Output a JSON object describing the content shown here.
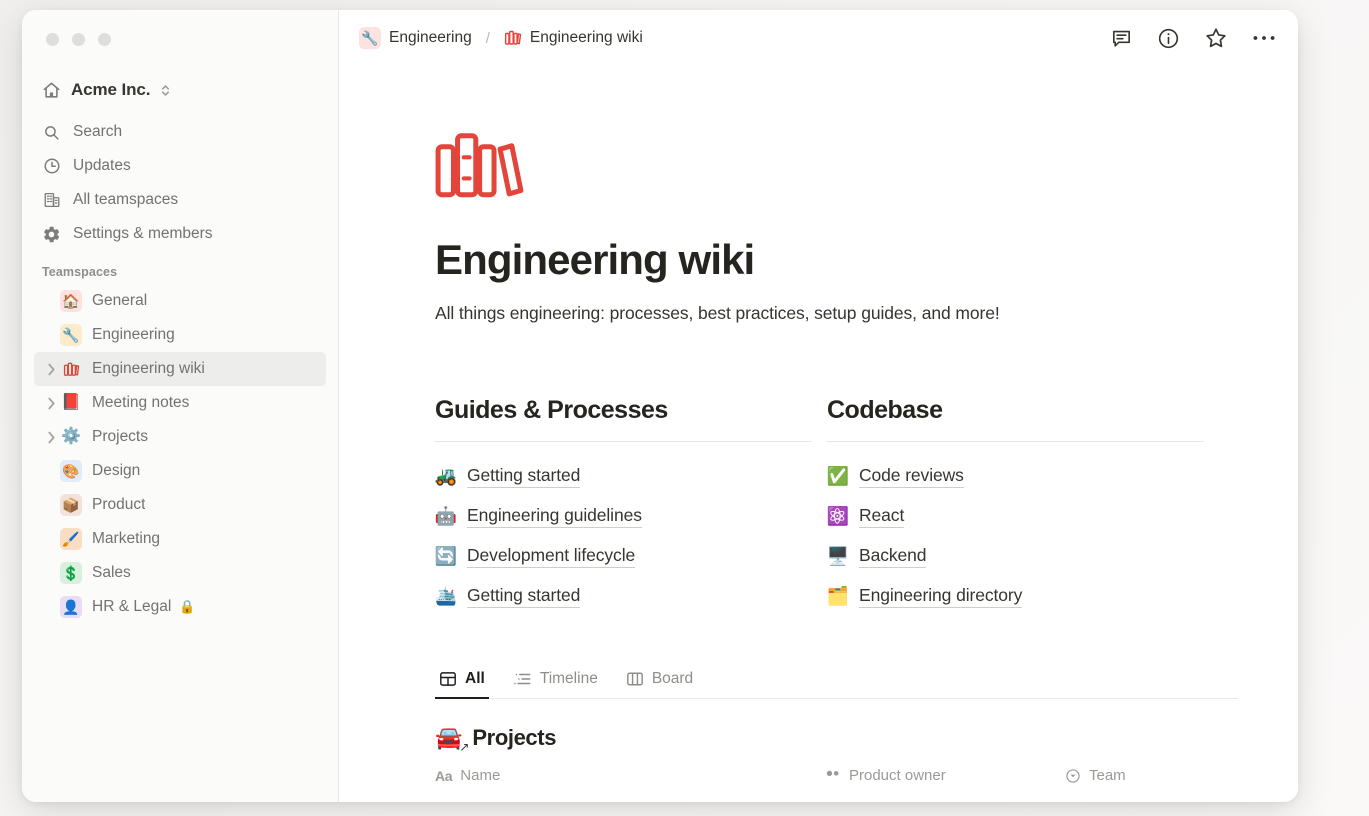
{
  "window": {
    "traffic_lights": [
      "close",
      "minimize",
      "zoom"
    ]
  },
  "sidebar": {
    "workspace": {
      "name": "Acme Inc.",
      "icon": "home-icon"
    },
    "nav": [
      {
        "label": "Search",
        "icon": "search-icon"
      },
      {
        "label": "Updates",
        "icon": "clock-icon"
      },
      {
        "label": "All teamspaces",
        "icon": "buildings-icon"
      },
      {
        "label": "Settings & members",
        "icon": "gear-icon"
      }
    ],
    "section_label": "Teamspaces",
    "teamspaces": [
      {
        "label": "General",
        "emoji": "🏠",
        "emoji_bg": "#ffe2e0",
        "expandable": false,
        "selected": false,
        "locked": false
      },
      {
        "label": "Engineering",
        "emoji": "🔧",
        "emoji_bg": "#fdeccb",
        "expandable": false,
        "selected": false,
        "locked": false
      },
      {
        "label": "Engineering wiki",
        "emoji": "📚",
        "emoji_bg": "transparent",
        "expandable": true,
        "selected": true,
        "locked": false
      },
      {
        "label": "Meeting notes",
        "emoji": "📕",
        "emoji_bg": "transparent",
        "expandable": true,
        "selected": false,
        "locked": false
      },
      {
        "label": "Projects",
        "emoji": "⚙️",
        "emoji_bg": "transparent",
        "expandable": true,
        "selected": false,
        "locked": false
      },
      {
        "label": "Design",
        "emoji": "🎨",
        "emoji_bg": "#e1ecfb",
        "expandable": false,
        "selected": false,
        "locked": false
      },
      {
        "label": "Product",
        "emoji": "📦",
        "emoji_bg": "#f1e2dc",
        "expandable": false,
        "selected": false,
        "locked": false
      },
      {
        "label": "Marketing",
        "emoji": "🖌️",
        "emoji_bg": "#fbddc3",
        "expandable": false,
        "selected": false,
        "locked": false
      },
      {
        "label": "Sales",
        "emoji": "💲",
        "emoji_bg": "#d9f0df",
        "expandable": false,
        "selected": false,
        "locked": false
      },
      {
        "label": "HR & Legal",
        "emoji": "👤",
        "emoji_bg": "#e8dcf7",
        "expandable": false,
        "selected": false,
        "locked": true,
        "lock_glyph": "🔒"
      }
    ]
  },
  "topbar": {
    "breadcrumb": [
      {
        "label": "Engineering",
        "emoji": "🔧",
        "emoji_bg": "#fde2df"
      },
      {
        "label": "Engineering wiki",
        "emoji": "📚",
        "emoji_bg": "transparent"
      }
    ],
    "separator": "/",
    "icons": [
      {
        "name": "comment-icon"
      },
      {
        "name": "info-icon"
      },
      {
        "name": "star-icon"
      },
      {
        "name": "more-options-icon"
      }
    ]
  },
  "page": {
    "icon_name": "books-icon",
    "icon_color": "#e3453a",
    "title": "Engineering wiki",
    "subtitle": "All things engineering: processes, best practices, setup guides, and more!"
  },
  "columns": [
    {
      "heading": "Guides & Processes",
      "links": [
        {
          "label": "Getting started",
          "emoji": "🚜"
        },
        {
          "label": "Engineering guidelines",
          "emoji": "🤖"
        },
        {
          "label": "Development lifecycle",
          "emoji": "🔄"
        },
        {
          "label": "Getting started",
          "emoji": "🛳️"
        }
      ]
    },
    {
      "heading": "Codebase",
      "links": [
        {
          "label": "Code reviews",
          "emoji": "✅"
        },
        {
          "label": "React",
          "emoji": "⚛️"
        },
        {
          "label": "Backend",
          "emoji": "🖥️"
        },
        {
          "label": "Engineering directory",
          "emoji": "🗂️"
        }
      ]
    }
  ],
  "database": {
    "tabs": [
      {
        "label": "All",
        "icon": "table-icon",
        "active": true
      },
      {
        "label": "Timeline",
        "icon": "list-icon",
        "active": false
      },
      {
        "label": "Board",
        "icon": "board-icon",
        "active": false
      }
    ],
    "title": "Projects",
    "title_emoji": "🚘",
    "columns": [
      {
        "label": "Name",
        "icon": "text-type-icon",
        "icon_glyph": "Aa"
      },
      {
        "label": "Product owner",
        "icon": "person-icon"
      },
      {
        "label": "Team",
        "icon": "select-icon"
      }
    ]
  }
}
